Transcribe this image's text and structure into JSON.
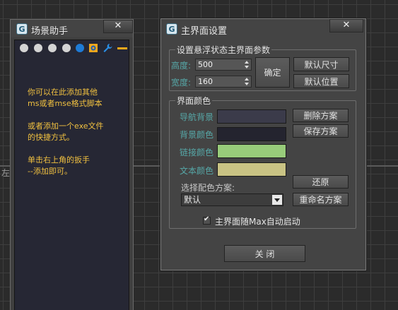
{
  "viewport": {
    "label": "左"
  },
  "left_panel": {
    "title": "场景助手",
    "close_label": "✕",
    "help": [
      "你可以在此添加其他\nms或者mse格式脚本",
      "或者添加一个exe文件\n的快捷方式。",
      "单击右上角的扳手\n--添加即可。"
    ],
    "colors": {
      "help_text": "#f0c040",
      "body_bg": "#262734"
    }
  },
  "dialog": {
    "title": "主界面设置",
    "close_label": "✕",
    "float_group": {
      "title": "设置悬浮状态主界面参数",
      "height_label": "高度:",
      "height_value": "500",
      "width_label": "宽度:",
      "width_value": "160",
      "ok_label": "确定",
      "default_size_label": "默认尺寸",
      "default_pos_label": "默认位置"
    },
    "color_group": {
      "title": "界面颜色",
      "rows": [
        {
          "label": "导航背景",
          "color": "#3b3b4a"
        },
        {
          "label": "背景颜色",
          "color": "#24242f"
        },
        {
          "label": "链接颜色",
          "color": "#98cc7a"
        },
        {
          "label": "文本颜色",
          "color": "#c9c384"
        }
      ],
      "delete_scheme_label": "删除方案",
      "save_scheme_label": "保存方案",
      "restore_label": "还原",
      "rename_scheme_label": "重命名方案",
      "scheme_prompt": "选择配色方案:",
      "scheme_selected": "默认"
    },
    "autostart": {
      "label": "主界面随Max自动启动",
      "checked": true
    },
    "close_button_label": "关 闭"
  }
}
